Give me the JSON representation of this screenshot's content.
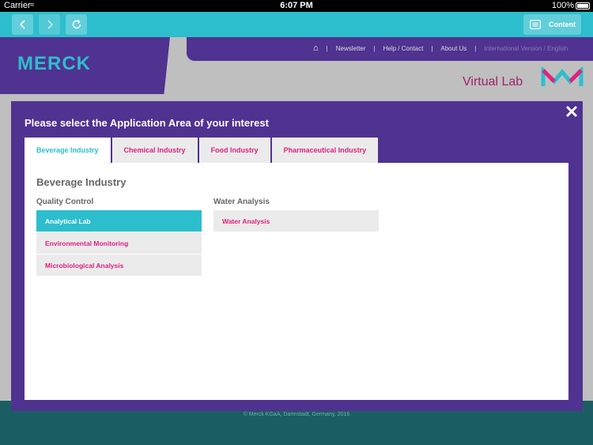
{
  "status_bar": {
    "carrier": "Carrier",
    "time": "6:07 PM",
    "battery": "100%"
  },
  "toolbar": {
    "content_label": "Content"
  },
  "background_page": {
    "logo": "MERCK",
    "nav": [
      "Newsletter",
      "Help / Contact",
      "About Us",
      "International Version / English"
    ],
    "virtual_lab": "Virtual Lab",
    "footer": "© Merck KGaA, Darmstadt, Germany, 2016"
  },
  "modal": {
    "title": "Please select the Application Area of your interest",
    "tabs": [
      {
        "label": "Beverage Industry",
        "active": true
      },
      {
        "label": "Chemical Industry",
        "active": false
      },
      {
        "label": "Food Industry",
        "active": false
      },
      {
        "label": "Pharmaceutical Industry",
        "active": false
      }
    ],
    "panel_title": "Beverage Industry",
    "groups": [
      {
        "title": "Quality Control",
        "items": [
          {
            "label": "Analytical Lab",
            "selected": true
          },
          {
            "label": "Environmental Monitoring",
            "selected": false
          },
          {
            "label": "Microbiological Analysis",
            "selected": false
          }
        ]
      },
      {
        "title": "Water Analysis",
        "items": [
          {
            "label": "Water Analysis",
            "selected": false
          }
        ]
      }
    ]
  },
  "colors": {
    "accent_teal": "#2dbecd",
    "brand_purple": "#503291",
    "link_magenta": "#e0217d"
  }
}
